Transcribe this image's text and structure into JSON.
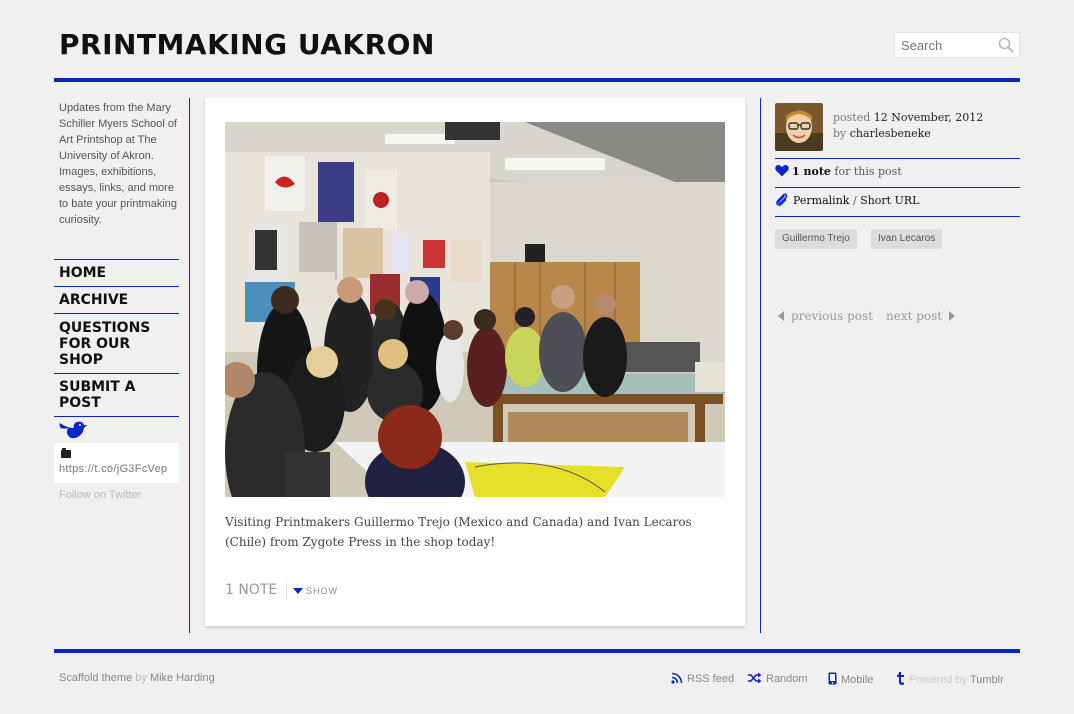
{
  "site": {
    "title": "PRINTMAKING UAKRON",
    "search_placeholder": "Search",
    "description": "Updates from the Mary Schiller Myers School of Art Printshop at The University of Akron. Images, exhibitions, essays, links, and more to bate your printmaking curiosity."
  },
  "nav": {
    "items": [
      {
        "label": "HOME"
      },
      {
        "label": "ARCHIVE"
      },
      {
        "label": "QUESTIONS FOR OUR SHOP"
      },
      {
        "label": "SUBMIT A POST"
      }
    ]
  },
  "twitter": {
    "tweet_text": "https://t.co/jG3FcVep",
    "follow_label": "Follow on Twitter"
  },
  "post": {
    "caption": "Visiting Printmakers Guillermo Trejo (Mexico and Canada) and Ivan Lecaros (Chile) from Zygote Press in the shop today!",
    "notes_label": "1 NOTE",
    "show_label": "SHOW"
  },
  "meta": {
    "posted_prefix": "posted",
    "date": "12 November, 2012",
    "by_prefix": "by",
    "author": "charlesbeneke",
    "notes_strong": "1 note",
    "notes_suffix": "for this post",
    "permalink": "Permalink",
    "sep": "/",
    "short_url": "Short URL",
    "tags": [
      "Guillermo Trejo",
      "Ivan Lecaros"
    ],
    "previous": "previous post",
    "next": "next post"
  },
  "footer": {
    "theme": "Scaffold theme",
    "by": "by",
    "designer": "Mike Harding",
    "rss": "RSS feed",
    "random": "Random",
    "mobile": "Mobile",
    "powered_by": "Powered by",
    "tumblr": "Tumblr"
  },
  "colors": {
    "accent": "#0c25c5",
    "background": "#f0f0f0"
  },
  "icons": [
    "search-icon",
    "twitter-bird-icon",
    "tweet-icon",
    "heart-icon",
    "paperclip-icon",
    "arrow-left-icon",
    "arrow-right-icon",
    "rss-icon",
    "shuffle-icon",
    "mobile-icon",
    "tumblr-icon"
  ]
}
